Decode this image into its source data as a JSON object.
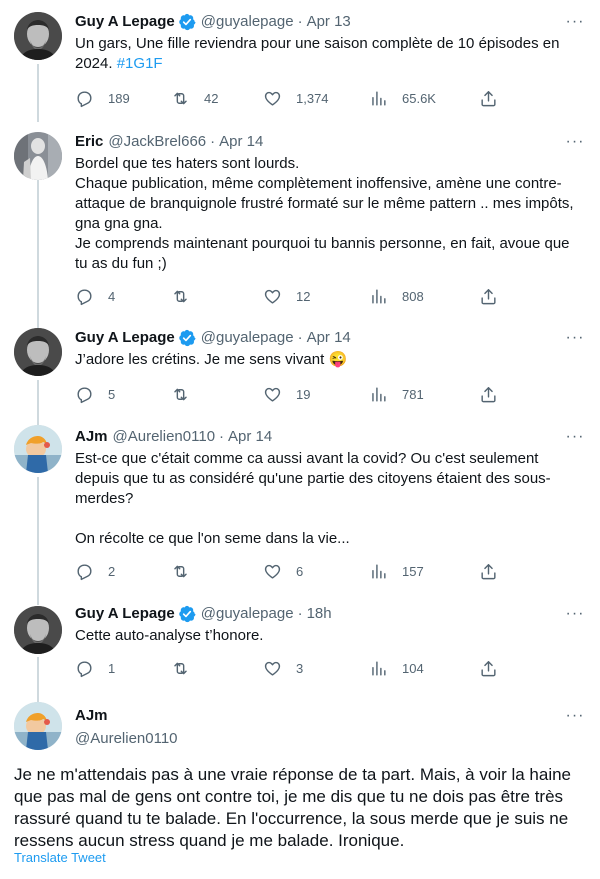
{
  "tweets": [
    {
      "name": "Guy A Lepage",
      "verified": true,
      "handle": "@guyalepage",
      "time": "Apr 13",
      "text": "Un gars, Une fille reviendra pour une saison complète de 10 épisodes en 2024. ",
      "hashtag": "#1G1F",
      "replies": "189",
      "retweets": "42",
      "likes": "1,374",
      "views": "65.6K"
    },
    {
      "name": "Eric",
      "verified": false,
      "handle": "@JackBrel666",
      "time": "Apr 14",
      "text": "Bordel que tes haters sont lourds.\nChaque publication, même complètement inoffensive, amène une contre-attaque de branquignole frustré formaté sur le même pattern .. mes impôts, gna gna gna.\nJe comprends maintenant pourquoi tu bannis personne, en fait, avoue que tu as du fun ;)",
      "replies": "4",
      "retweets": "",
      "likes": "12",
      "views": "808"
    },
    {
      "name": "Guy A Lepage",
      "verified": true,
      "handle": "@guyalepage",
      "time": "Apr 14",
      "text": "J’adore les crétins. Je me sens vivant ",
      "emoji": "😜",
      "replies": "5",
      "retweets": "",
      "likes": "19",
      "views": "781"
    },
    {
      "name": "AJm",
      "verified": false,
      "handle": "@Aurelien0110",
      "time": "Apr 14",
      "text": "Est-ce que c'était comme ca aussi avant la covid? Ou c'est seulement depuis que tu as considéré qu'une partie des citoyens étaient des sous-merdes?\n\nOn récolte ce que l'on seme dans la vie...",
      "replies": "2",
      "retweets": "",
      "likes": "6",
      "views": "157"
    },
    {
      "name": "Guy A Lepage",
      "verified": true,
      "handle": "@guyalepage",
      "time": "18h",
      "text": "Cette auto-analyse t’honore.",
      "replies": "1",
      "retweets": "",
      "likes": "3",
      "views": "104"
    }
  ],
  "final_tweet": {
    "name": "AJm",
    "handle": "@Aurelien0110",
    "text": "Je ne m'attendais pas à une vraie réponse de ta part. Mais, à voir la haine que pas mal de gens ont contre toi, je me dis que tu ne dois pas être très rassuré quand tu te balade. En l'occurrence, la sous merde que je suis ne ressens aucun stress quand je me balade. Ironique.",
    "translate": "Translate Tweet"
  },
  "ui": {
    "dot": "·",
    "more": "···"
  },
  "colors": {
    "accent": "#1d9bf0",
    "text": "#0f1419",
    "secondary": "#536471",
    "thread_line": "#cfd9de"
  }
}
